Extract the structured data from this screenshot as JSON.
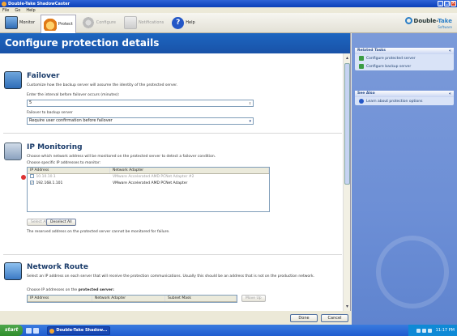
{
  "window": {
    "title": "Double-Take ShadowCaster"
  },
  "menu": {
    "items": [
      "File",
      "Go",
      "Help"
    ]
  },
  "toolbar": {
    "monitor": "Monitor",
    "protect": "Protect",
    "configure": "Configure",
    "notifications": "Notifications",
    "help": "Help",
    "logo_double": "Double-",
    "logo_take": "Take",
    "logo_sub": "Software"
  },
  "page": {
    "title": "Configure protection details"
  },
  "failover": {
    "title": "Failover",
    "desc": "Customize how the backup server will assume the identity of the protected server.",
    "interval_label": "Enter the interval before failover occurs (minutes):",
    "interval_value": "5",
    "failover_label": "Failover to backup server",
    "failover_value": "Require user confirmation before failover"
  },
  "ip_monitoring": {
    "title": "IP Monitoring",
    "desc": "Choose which network address will be monitored on the protected server to detect a failover condition.",
    "choose_label": "Choose specific IP addresses to monitor:",
    "columns": [
      "IP Address",
      "Network Adapter"
    ],
    "rows": [
      {
        "ip": "10.10.10.1",
        "adapter": "VMware Accelerated AMD PCNet Adapter #2"
      },
      {
        "ip": "192.168.1.101",
        "adapter": "VMware Accelerated AMD PCNet Adapter"
      }
    ],
    "select_all": "Select All",
    "deselect_all": "Deselect All",
    "note": "The reserved address on the protected server cannot be monitored for failure."
  },
  "network_route": {
    "title": "Network Route",
    "desc": "Select an IP address on each server that will receive the protection communications. Usually this should be an address that is not on the production network.",
    "choose_label": "Choose IP addresses on the ",
    "choose_bold": "protected server:",
    "columns": [
      "IP Address",
      "Network Adapter",
      "Subnet Mask"
    ],
    "move_up": "Move Up"
  },
  "footer": {
    "done": "Done",
    "cancel": "Cancel"
  },
  "taskpane": {
    "related_title": "Related Tasks",
    "related_items": [
      "Configure protected server",
      "Configure backup server"
    ],
    "see_also_title": "See Also",
    "see_also_items": [
      "Learn about protection options"
    ]
  },
  "taskbar": {
    "start": "start",
    "task": "Double-Take Shadow...",
    "clock": "11:17 PM"
  }
}
